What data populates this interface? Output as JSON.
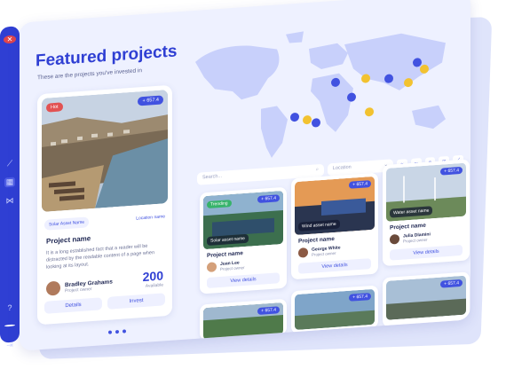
{
  "header": {
    "title": "Featured projects",
    "subtitle": "These are the projects you've invested in"
  },
  "featured": {
    "badge": "Hot",
    "price": "+ 657.4",
    "asset_type": "Solar Asset Name",
    "location": "Location name",
    "name": "Project name",
    "description": "It is a long established fact that a reader will be distracted by the readable content of a page when looking at its layout.",
    "owner_name": "Bradley Grahams",
    "owner_role": "Project owner",
    "available_count": "200",
    "available_label": "Available",
    "details_label": "Details",
    "invest_label": "Invest"
  },
  "toolbar": {
    "search_placeholder": "Search...",
    "location_placeholder": "Location"
  },
  "cards": [
    {
      "price": "+ 657.4",
      "trend": "Trending",
      "type": "Solar asset name",
      "name": "Project name",
      "owner": "Juan Lee",
      "role": "Project owner",
      "button": "View details"
    },
    {
      "price": "+ 657.4",
      "type": "Wind asset name",
      "name": "Project name",
      "owner": "George White",
      "role": "Project owner",
      "button": "View details"
    },
    {
      "price": "+ 657.4",
      "type": "Water asset name",
      "name": "Project name",
      "owner": "Julia Dlamini",
      "role": "Project owner",
      "button": "View details"
    },
    {
      "price": "+ 657.4"
    },
    {
      "price": "+ 657.4"
    },
    {
      "price": "+ 657.4"
    }
  ],
  "colors": {
    "primary": "#2f3fd3",
    "hot": "#e25252",
    "trending": "#37b36a",
    "pin_blue": "#4152e0",
    "pin_yellow": "#f2c230"
  }
}
